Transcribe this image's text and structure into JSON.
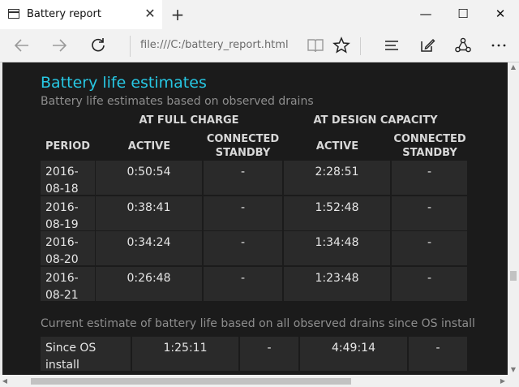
{
  "browser": {
    "tab_title": "Battery report",
    "tab_close_label": "✕",
    "new_tab_label": "+",
    "address": "file:///C:/battery_report.html",
    "window_minimize": "—",
    "window_maximize": "☐",
    "window_close": "✕"
  },
  "icons": {
    "back": "back-arrow-icon",
    "forward": "forward-arrow-icon",
    "refresh": "refresh-icon",
    "reading_view": "reading-view-icon",
    "favorites": "star-icon",
    "hub": "hub-icon",
    "note": "web-note-icon",
    "share": "share-icon",
    "more": "more-icon"
  },
  "report": {
    "title": "Battery life estimates",
    "subtitle": "Battery life estimates based on observed drains",
    "group_full": "AT FULL CHARGE",
    "group_design": "AT DESIGN CAPACITY",
    "col_period": "PERIOD",
    "col_active_full": "ACTIVE",
    "col_standby_full_1": "CONNECTED",
    "col_standby_full_2": "STANDBY",
    "col_active_design": "ACTIVE",
    "col_standby_design_1": "CONNECTED",
    "col_standby_design_2": "STANDBY",
    "rows": [
      {
        "period_1": "2016-",
        "period_2": "08-18",
        "active_full": "0:50:54",
        "standby_full": "-",
        "active_design": "2:28:51",
        "standby_design": "-"
      },
      {
        "period_1": "2016-",
        "period_2": "08-19",
        "active_full": "0:38:41",
        "standby_full": "-",
        "active_design": "1:52:48",
        "standby_design": "-"
      },
      {
        "period_1": "2016-",
        "period_2": "08-20",
        "active_full": "0:34:24",
        "standby_full": "-",
        "active_design": "1:34:48",
        "standby_design": "-"
      },
      {
        "period_1": "2016-",
        "period_2": "08-21",
        "active_full": "0:26:48",
        "standby_full": "-",
        "active_design": "1:23:48",
        "standby_design": "-"
      }
    ],
    "current_note": "Current estimate of battery life based on all observed drains since OS install",
    "since_install": {
      "period_1": "Since OS",
      "period_2": "install",
      "active_full": "1:25:11",
      "standby_full": "-",
      "active_design": "4:49:14",
      "standby_design": "-"
    }
  },
  "colors": {
    "heading": "#27c7e3",
    "background": "#1b1b1b",
    "cell": "#2a2a2a"
  }
}
